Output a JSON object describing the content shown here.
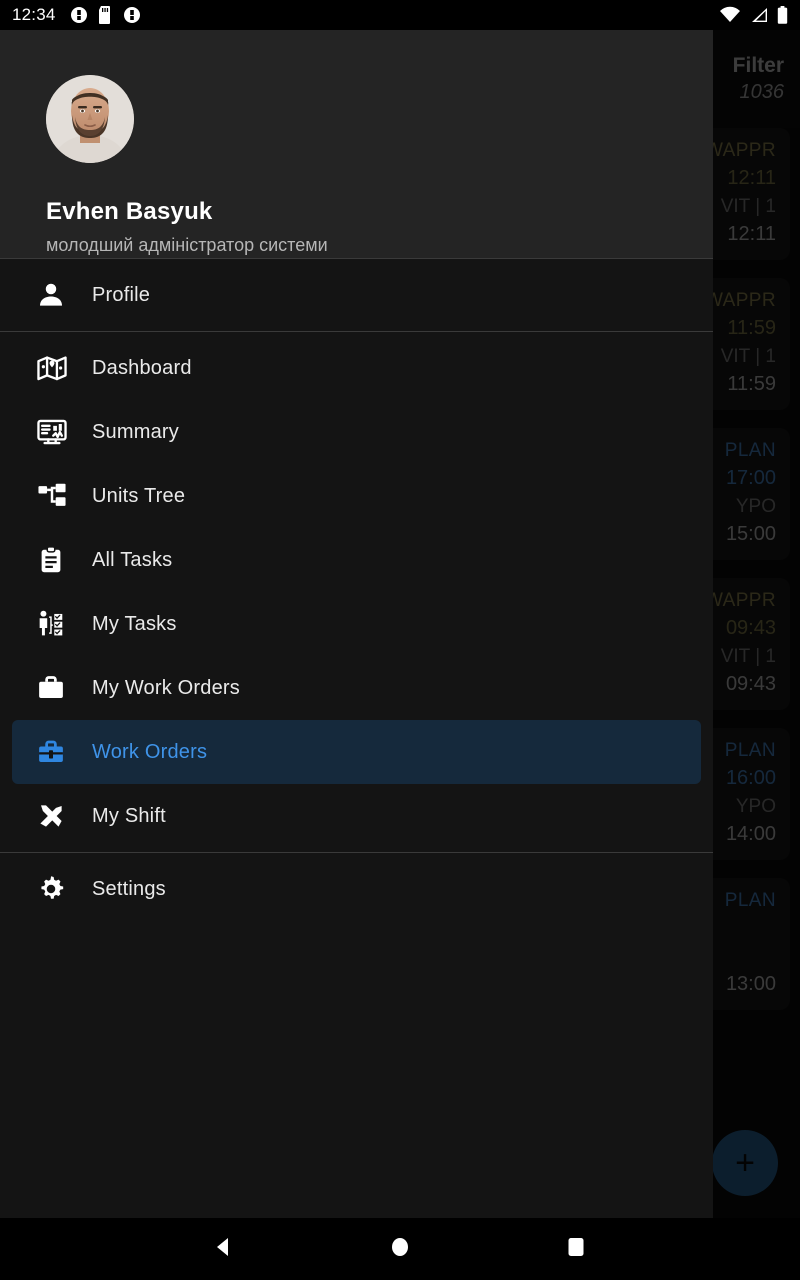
{
  "status_bar": {
    "time": "12:34",
    "left_icons": [
      "notification-icon",
      "sd-card-icon",
      "notification-icon"
    ],
    "right_icons": [
      "wifi-icon",
      "cellular-signal-icon",
      "battery-icon"
    ]
  },
  "background_screen": {
    "appbar": {
      "filter_label": "Filter",
      "count": "1036"
    },
    "cards": [
      {
        "status": "WAPPR",
        "status_kind": "wappr",
        "time": "12:11",
        "sub": "VIT | 1",
        "time2": "12:11"
      },
      {
        "status": "WAPPR",
        "status_kind": "wappr",
        "time": "11:59",
        "sub": "VIT | 1",
        "time2": "11:59"
      },
      {
        "status": "PLAN",
        "status_kind": "plan",
        "time": "17:00",
        "sub": "YPO",
        "time2": "15:00"
      },
      {
        "status": "WAPPR",
        "status_kind": "wappr",
        "time": "09:43",
        "sub": "VIT | 1",
        "time2": "09:43"
      },
      {
        "status": "PLAN",
        "status_kind": "plan",
        "time": "16:00",
        "sub": "YPO",
        "time2": "14:00"
      },
      {
        "status": "PLAN",
        "status_kind": "plan",
        "time": "",
        "sub": "",
        "time2": "13:00"
      }
    ],
    "fab": {
      "icon": "plus-icon",
      "label": "+"
    }
  },
  "drawer": {
    "profile": {
      "avatar": "user-avatar-photo",
      "name": "Evhen Basyuk",
      "role": "молодший адміністратор системи"
    },
    "groups": [
      {
        "items": [
          {
            "id": "profile",
            "label": "Profile",
            "icon": "person-icon",
            "selected": false
          }
        ]
      },
      {
        "items": [
          {
            "id": "dashboard",
            "label": "Dashboard",
            "icon": "map-icon",
            "selected": false
          },
          {
            "id": "summary",
            "label": "Summary",
            "icon": "monitor-chart-icon",
            "selected": false
          },
          {
            "id": "units-tree",
            "label": "Units Tree",
            "icon": "org-tree-icon",
            "selected": false
          },
          {
            "id": "all-tasks",
            "label": "All Tasks",
            "icon": "clipboard-icon",
            "selected": false
          },
          {
            "id": "my-tasks",
            "label": "My Tasks",
            "icon": "person-tasks-icon",
            "selected": false
          },
          {
            "id": "my-work-orders",
            "label": "My Work Orders",
            "icon": "briefcase-icon",
            "selected": false
          },
          {
            "id": "work-orders",
            "label": "Work Orders",
            "icon": "toolbox-icon",
            "selected": true
          },
          {
            "id": "my-shift",
            "label": "My Shift",
            "icon": "tools-icon",
            "selected": false
          }
        ]
      },
      {
        "items": [
          {
            "id": "settings",
            "label": "Settings",
            "icon": "gear-icon",
            "selected": false
          }
        ]
      }
    ],
    "colors": {
      "accent": "#3f93e8",
      "selected_bg": "#15293c",
      "surface": "#141414",
      "header_bg": "#242424"
    }
  },
  "system_nav": {
    "back": "back-triangle-icon",
    "home": "home-circle-icon",
    "recents": "recents-square-icon"
  }
}
